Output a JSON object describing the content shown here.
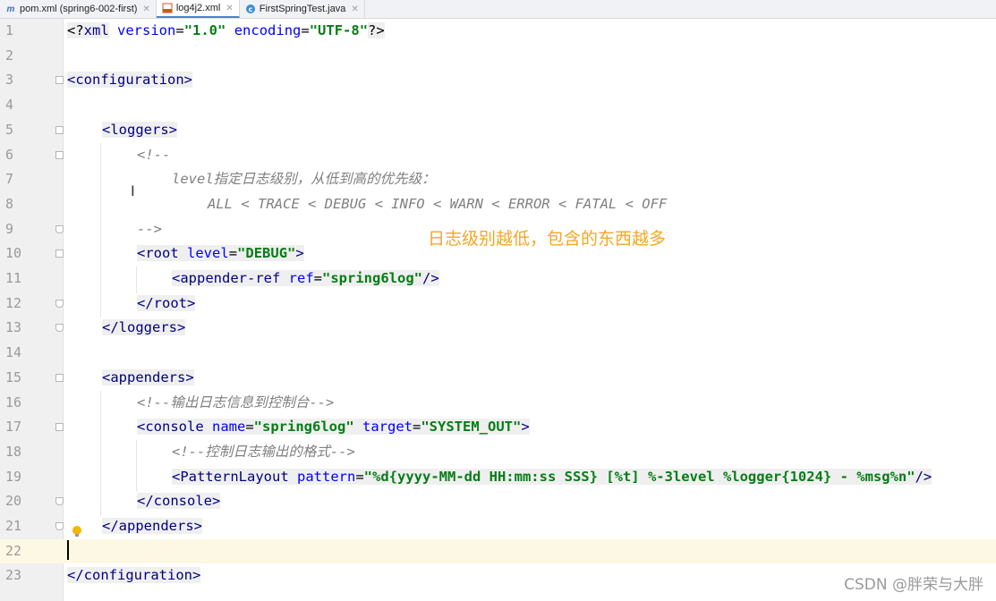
{
  "tabs": [
    {
      "label": "pom.xml (spring6-002-first)",
      "icon": "maven-icon",
      "active": false
    },
    {
      "label": "log4j2.xml",
      "icon": "xml-file-icon",
      "active": true
    },
    {
      "label": "FirstSpringTest.java",
      "icon": "java-class-icon",
      "active": false
    }
  ],
  "editor": {
    "line_numbers": [
      "1",
      "2",
      "3",
      "4",
      "5",
      "6",
      "7",
      "8",
      "9",
      "10",
      "11",
      "12",
      "13",
      "14",
      "15",
      "16",
      "17",
      "18",
      "19",
      "20",
      "21",
      "22",
      "23"
    ],
    "current_line": "22",
    "lines": {
      "l1": {
        "open": "<?",
        "name": "xml",
        "attr1": "version",
        "eq1": "=",
        "val1": "\"1.0\"",
        "attr2": "encoding",
        "eq2": "=",
        "val2": "\"UTF-8\"",
        "close": "?>"
      },
      "l3": "<configuration>",
      "l5": "<loggers>",
      "l6": "<!--",
      "l7": "level指定日志级别，从低到高的优先级：",
      "l8": "ALL < TRACE < DEBUG < INFO < WARN < ERROR < FATAL < OFF",
      "l9": "-->",
      "l10": {
        "open": "<root",
        "attr": "level",
        "eq": "=",
        "val": "\"DEBUG\"",
        "close": ">"
      },
      "l11": {
        "open": "<appender-ref",
        "attr": "ref",
        "eq": "=",
        "val": "\"spring6log\"",
        "close": "/>"
      },
      "l12": "</root>",
      "l13": "</loggers>",
      "l15": "<appenders>",
      "l16": "<!--输出日志信息到控制台-->",
      "l17": {
        "open": "<console",
        "attr1": "name",
        "eq1": "=",
        "val1": "\"spring6log\"",
        "attr2": "target",
        "eq2": "=",
        "val2": "\"SYSTEM_OUT\"",
        "close": ">"
      },
      "l18": "<!--控制日志输出的格式-->",
      "l19": {
        "open": "<PatternLayout",
        "attr": "pattern",
        "eq": "=",
        "val": "\"%d{yyyy-MM-dd HH:mm:ss SSS} [%t] %-3level %logger{1024} - %msg%n\"",
        "close": "/>"
      },
      "l20": "</console>",
      "l21": "</appenders>",
      "l23": "</configuration>"
    }
  },
  "annotation": "日志级别越低，包含的东西越多",
  "watermark": "CSDN @胖荣与大胖",
  "colors": {
    "annotation": "#f5a623",
    "tag": "#000080",
    "attr": "#0000ff",
    "value": "#067d17",
    "comment": "#808080",
    "current_line": "#fdf8e3"
  }
}
